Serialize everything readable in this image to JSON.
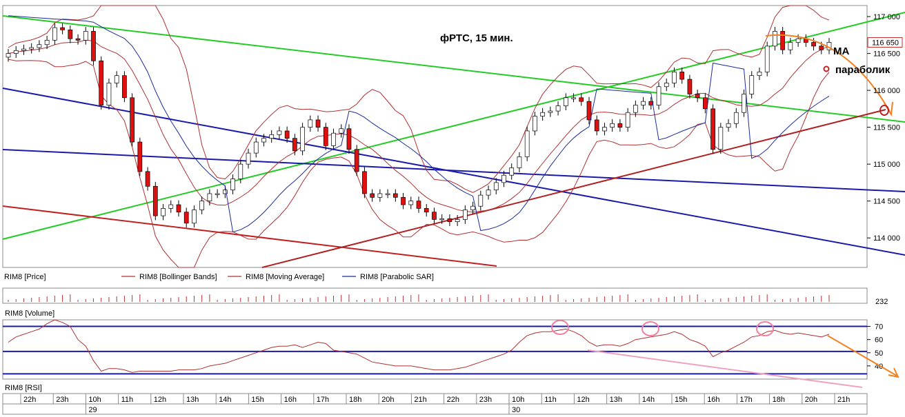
{
  "chart_data": {
    "type": "candlestick",
    "title": "фРТС, 15 мин.",
    "instrument": "RIM8",
    "y_range": [
      113600,
      117150
    ],
    "y_ticks": [
      "117 000",
      "116 500",
      "116 000",
      "115 500",
      "115 000",
      "114 500",
      "114 000"
    ],
    "last_price": "116 650",
    "volume_last": "232",
    "rsi_ticks": [
      "70",
      "60",
      "50",
      "40"
    ],
    "rsi_levels": [
      70,
      51,
      34
    ],
    "annotations": {
      "ma": "MA",
      "parabolic": "параболик"
    },
    "legend": [
      {
        "label": "RIM8 [Price]",
        "color": "#ffffff"
      },
      {
        "label": "RIM8 [Bollinger Bands]",
        "color": "#b03030"
      },
      {
        "label": "RIM8 [Moving Average]",
        "color": "#b03030"
      },
      {
        "label": "RIM8 [Parabolic SAR]",
        "color": "#1a2a9a"
      }
    ],
    "panel_titles": {
      "volume": "RIM8 [Volume]",
      "rsi": "RIM8 [RSI]"
    },
    "x_labels": [
      "22h",
      "23h",
      "10h",
      "11h",
      "12h",
      "13h",
      "14h",
      "15h",
      "16h",
      "17h",
      "18h",
      "20h",
      "21h",
      "22h",
      "23h",
      "10h",
      "11h",
      "12h",
      "13h",
      "14h",
      "15h",
      "16h",
      "17h",
      "18h",
      "20h",
      "21h"
    ],
    "day_labels": [
      {
        "label": "29",
        "at_index": 2
      },
      {
        "label": "30",
        "at_index": 15
      }
    ],
    "close": [
      116500,
      116540,
      116560,
      116580,
      116620,
      116680,
      116850,
      116820,
      116700,
      116680,
      116800,
      116400,
      115800,
      116100,
      116200,
      115900,
      115300,
      114900,
      114700,
      114300,
      114400,
      114450,
      114350,
      114200,
      114380,
      114500,
      114600,
      114600,
      114650,
      114800,
      115000,
      115150,
      115300,
      115350,
      115400,
      115450,
      115350,
      115180,
      115500,
      115600,
      115500,
      115250,
      115420,
      115480,
      115200,
      114900,
      114600,
      114550,
      114600,
      114600,
      114550,
      114450,
      114500,
      114400,
      114350,
      114250,
      114260,
      114220,
      114250,
      114380,
      114430,
      114580,
      114650,
      114750,
      114850,
      114950,
      115100,
      115450,
      115650,
      115700,
      115720,
      115790,
      115900,
      115900,
      115850,
      115600,
      115450,
      115500,
      115550,
      115500,
      115700,
      115800,
      115850,
      115800,
      116050,
      116100,
      116250,
      116150,
      115950,
      115900,
      115750,
      115200,
      115500,
      115550,
      115700,
      115950,
      116200,
      116250,
      116600,
      116800,
      116550,
      116650,
      116700,
      116650,
      116600,
      116550,
      116650
    ],
    "open": [
      116450,
      116500,
      116540,
      116560,
      116580,
      116620,
      116680,
      116850,
      116820,
      116700,
      116680,
      116800,
      116400,
      115800,
      116100,
      116200,
      115900,
      115300,
      114900,
      114700,
      114300,
      114400,
      114450,
      114350,
      114200,
      114380,
      114500,
      114600,
      114600,
      114650,
      114800,
      115000,
      115150,
      115300,
      115350,
      115400,
      115450,
      115350,
      115180,
      115500,
      115600,
      115500,
      115250,
      115420,
      115480,
      115200,
      114900,
      114600,
      114550,
      114600,
      114600,
      114550,
      114450,
      114500,
      114400,
      114350,
      114250,
      114260,
      114220,
      114250,
      114380,
      114430,
      114580,
      114650,
      114750,
      114850,
      114950,
      115100,
      115450,
      115650,
      115700,
      115720,
      115790,
      115900,
      115900,
      115850,
      115600,
      115450,
      115500,
      115550,
      115500,
      115700,
      115800,
      115850,
      115800,
      116050,
      116100,
      116250,
      116150,
      115950,
      115900,
      115750,
      115200,
      115500,
      115550,
      115700,
      115950,
      116200,
      116250,
      116600,
      116800,
      116550,
      116650,
      116700,
      116650,
      116600,
      116550
    ],
    "rsi": [
      58,
      62,
      64,
      66,
      68,
      72,
      75,
      73,
      70,
      60,
      55,
      44,
      36,
      38,
      38,
      37,
      35,
      36,
      36,
      36,
      36,
      36,
      37,
      37,
      37,
      38,
      40,
      41,
      42,
      44,
      46,
      48,
      50,
      52,
      54,
      55,
      55,
      56,
      54,
      56,
      58,
      57,
      52,
      51,
      50,
      49,
      46,
      43,
      42,
      41,
      40,
      40,
      40,
      39,
      38,
      37,
      37,
      37,
      38,
      39,
      41,
      43,
      45,
      47,
      49,
      52,
      58,
      63,
      65,
      66,
      66,
      67,
      68,
      66,
      63,
      58,
      55,
      56,
      56,
      55,
      57,
      60,
      61,
      62,
      63,
      64,
      66,
      64,
      60,
      58,
      55,
      47,
      50,
      52,
      55,
      58,
      62,
      63,
      66,
      67,
      65,
      64,
      65,
      64,
      63,
      62,
      64
    ]
  }
}
